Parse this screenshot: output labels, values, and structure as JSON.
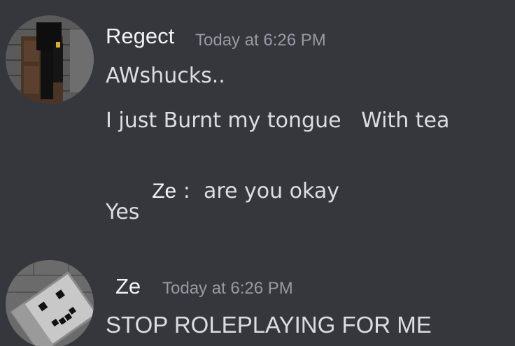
{
  "messages": [
    {
      "author": "Regect",
      "timestamp": "Today at 6:26 PM",
      "avatar_icon": "minecraft-character-avatar",
      "lines": [
        "AWshucks..",
        "I just Burnt my tongue   With tea",
        {
          "speaker": "Ze",
          "separator": " :  ",
          "text": "are you okay"
        },
        "Yes"
      ]
    },
    {
      "author": "Ze",
      "timestamp": "Today at 6:26 PM",
      "avatar_icon": "minecraft-face-avatar",
      "lines": [
        "STOP ROLEPLAYING FOR ME"
      ]
    }
  ],
  "colors": {
    "background": "#36373d",
    "author": "#f2f3f5",
    "timestamp": "#989aa2",
    "message_text": "#dbdee1"
  }
}
